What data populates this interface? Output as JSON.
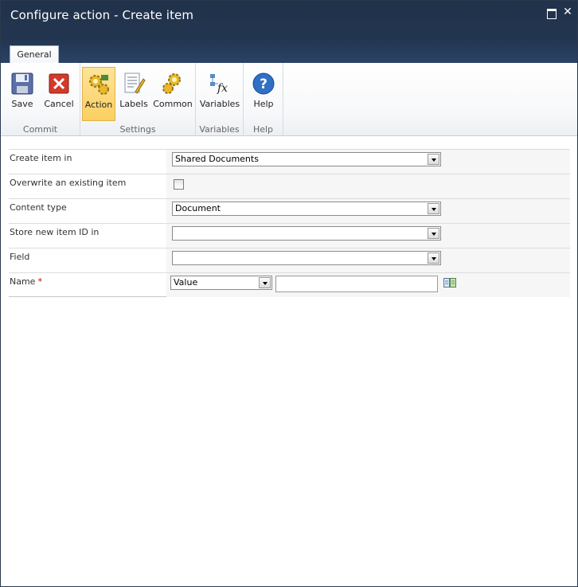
{
  "window": {
    "title": "Configure action - Create item"
  },
  "ribbon": {
    "tab": "General",
    "groups": {
      "commit": {
        "label": "Commit",
        "save": "Save",
        "cancel": "Cancel"
      },
      "settings": {
        "label": "Settings",
        "action": "Action",
        "labels": "Labels",
        "common": "Common"
      },
      "variables": {
        "label": "Variables",
        "variables": "Variables"
      },
      "help": {
        "label": "Help",
        "help": "Help"
      }
    }
  },
  "form": {
    "create_item_in": {
      "label": "Create item in",
      "value": "Shared Documents"
    },
    "overwrite": {
      "label": "Overwrite an existing item"
    },
    "content_type": {
      "label": "Content type",
      "value": "Document"
    },
    "store_id": {
      "label": "Store new item ID in",
      "value": ""
    },
    "field": {
      "label": "Field",
      "value": ""
    },
    "name": {
      "label": "Name",
      "required_mark": "*",
      "mode": "Value",
      "text": ""
    }
  },
  "colors": {
    "accent": "#223550",
    "active_button": "#fbcf62",
    "required": "#cc0000"
  }
}
